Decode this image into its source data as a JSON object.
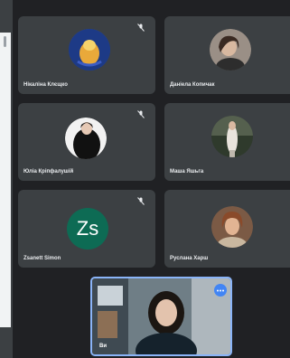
{
  "participants": [
    {
      "name": "Нікаліна Клєщко",
      "avatar": "photo-avatar"
    },
    {
      "name": "Даніела Копичак",
      "avatar": "photo-avatar"
    },
    {
      "name": "Юліа Кріпфалушій",
      "avatar": "photo-avatar"
    },
    {
      "name": "Маша Яшьга",
      "avatar": "photo-avatar"
    },
    {
      "name": "Zsanett Simon",
      "avatar": "initials-avatar",
      "initials": "Zs"
    },
    {
      "name": "Руслана Харш",
      "avatar": "photo-avatar"
    }
  ],
  "self_view": {
    "label": "Ви"
  },
  "colors": {
    "tile_bg": "#3c4043",
    "page_bg": "#202124",
    "initials_bg": "#0d6b54",
    "accent": "#8ab4f8"
  },
  "icons": [
    "muted-mic-icon",
    "more-options-icon"
  ]
}
